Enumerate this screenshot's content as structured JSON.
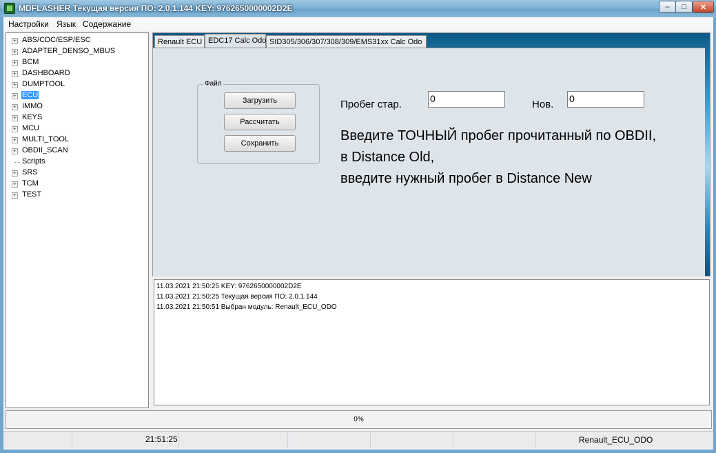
{
  "window": {
    "title": "MDFLASHER  Текущая версия ПО: 2.0.1.144  KEY: 976265000000 2D2E",
    "title_text": "MDFLASHER  Текущая версия ПО: 2.0.1.144  KEY: 9762650000002D2E",
    "min_glyph": "–",
    "max_glyph": "□",
    "close_glyph": "✕"
  },
  "menu": {
    "items": [
      "Настройки",
      "Язык",
      "Содержание"
    ]
  },
  "tree": {
    "items": [
      {
        "label": "ABS/CDC/ESP/ESC",
        "expandable": true
      },
      {
        "label": "ADAPTER_DENSO_MBUS",
        "expandable": true
      },
      {
        "label": "BCM",
        "expandable": true
      },
      {
        "label": "DASHBOARD",
        "expandable": true
      },
      {
        "label": "DUMPTOOL",
        "expandable": true
      },
      {
        "label": "ECU",
        "expandable": true,
        "selected": true
      },
      {
        "label": "IMMO",
        "expandable": true
      },
      {
        "label": "KEYS",
        "expandable": true
      },
      {
        "label": "MCU",
        "expandable": true
      },
      {
        "label": "MULTI_TOOL",
        "expandable": true
      },
      {
        "label": "OBDII_SCAN",
        "expandable": true
      },
      {
        "label": "Scripts",
        "expandable": false
      },
      {
        "label": "SRS",
        "expandable": true
      },
      {
        "label": "TCM",
        "expandable": true
      },
      {
        "label": "TEST",
        "expandable": true
      }
    ]
  },
  "tabs": [
    "Renault ECU",
    "EDC17 Calc Odo",
    "SID305/306/307/308/309/EMS31xx  Calc Odo"
  ],
  "active_tab": "EDC17 Calc Odo",
  "file_group": {
    "title": "Файл",
    "load_label": "Загрузить",
    "calc_label": "Рассчитать",
    "save_label": "Сохранить"
  },
  "odometer": {
    "old_label": "Пробег стар.",
    "old_value": "0",
    "new_label": "Нов.",
    "new_value": "0"
  },
  "instructions": [
    "Введите ТОЧНЫЙ пробег прочитанный по OBDII,",
    "в Distance Old,",
    "введите нужный пробег в Distance New"
  ],
  "log": [
    "11.03.2021 21:50:25  KEY: 9762650000002D2E",
    "11.03.2021 21:50:25  Текущая версия ПО: 2.0.1.144",
    "11.03.2021 21:50:51  Выбран модуль:  Renault_ECU_ODO"
  ],
  "progress": {
    "text": "0%",
    "value": 0
  },
  "status": {
    "time": "21:51:25",
    "module": "Renault_ECU_ODO"
  },
  "colors": {
    "selection": "#3399ff",
    "panel": "#dde4ea",
    "titlebar": "#7fb2d6"
  }
}
